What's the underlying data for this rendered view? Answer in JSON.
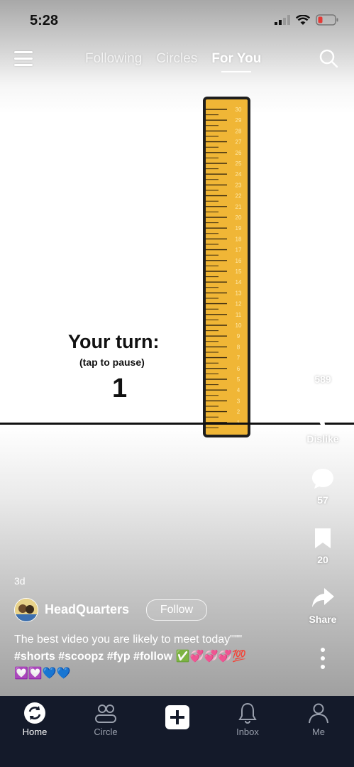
{
  "status": {
    "time": "5:28"
  },
  "nav": {
    "tabs": [
      "Following",
      "Circles",
      "For You"
    ],
    "active_tab": "For You"
  },
  "video": {
    "turn_title": "Your turn:",
    "turn_subtitle": "(tap to pause)",
    "turn_count": "1",
    "ruler_labels": [
      "30",
      "29",
      "28",
      "27",
      "26",
      "25",
      "24",
      "23",
      "22",
      "21",
      "20",
      "19",
      "18",
      "17",
      "16",
      "15",
      "14",
      "13",
      "12",
      "11",
      "10",
      "9",
      "8",
      "7",
      "6",
      "5",
      "4",
      "3",
      "2",
      "1"
    ]
  },
  "actions": {
    "like_count": "589",
    "dislike_label": "Dislike",
    "comment_count": "57",
    "save_count": "20",
    "share_label": "Share"
  },
  "post": {
    "age": "3d",
    "author": "HeadQuarters",
    "follow_label": "Follow",
    "caption": "The best video you are likely to meet today\"\"\"",
    "hashtags": "#shorts #scoopz #fyp #follow ✅💞💞💞💯",
    "emoji_line": "💟💟💙💙"
  },
  "bottom_nav": {
    "home": "Home",
    "circle": "Circle",
    "inbox": "Inbox",
    "me": "Me"
  },
  "colors": {
    "ruler": "#f0b636",
    "nav_bg": "#141a2a",
    "battery_low": "#e53935"
  }
}
